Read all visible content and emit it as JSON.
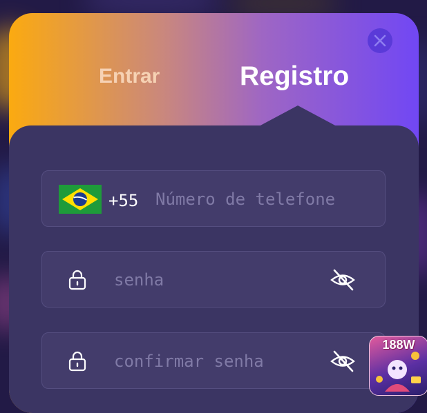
{
  "modal": {
    "tabs": {
      "login_label": "Entrar",
      "register_label": "Registro"
    },
    "active_tab": "Registro",
    "close_icon": "close-icon"
  },
  "form": {
    "phone": {
      "country": "Brazil",
      "flag_icon": "brazil-flag-icon",
      "dial_code": "+55",
      "placeholder": "Número de telefone",
      "value": ""
    },
    "password": {
      "placeholder": "senha",
      "value": "",
      "lock_icon": "lock-icon",
      "toggle_icon": "eye-off-icon"
    },
    "confirm_password": {
      "placeholder": "confirmar senha",
      "value": "",
      "lock_icon": "lock-icon",
      "toggle_icon": "eye-off-icon"
    }
  },
  "brand": {
    "badge_text": "188W"
  },
  "colors": {
    "gradient_start": "#fbaa10",
    "gradient_end": "#7147f4",
    "panel_bg": "#3b3563",
    "field_bg": "#433c6b",
    "placeholder": "#807aa6"
  }
}
